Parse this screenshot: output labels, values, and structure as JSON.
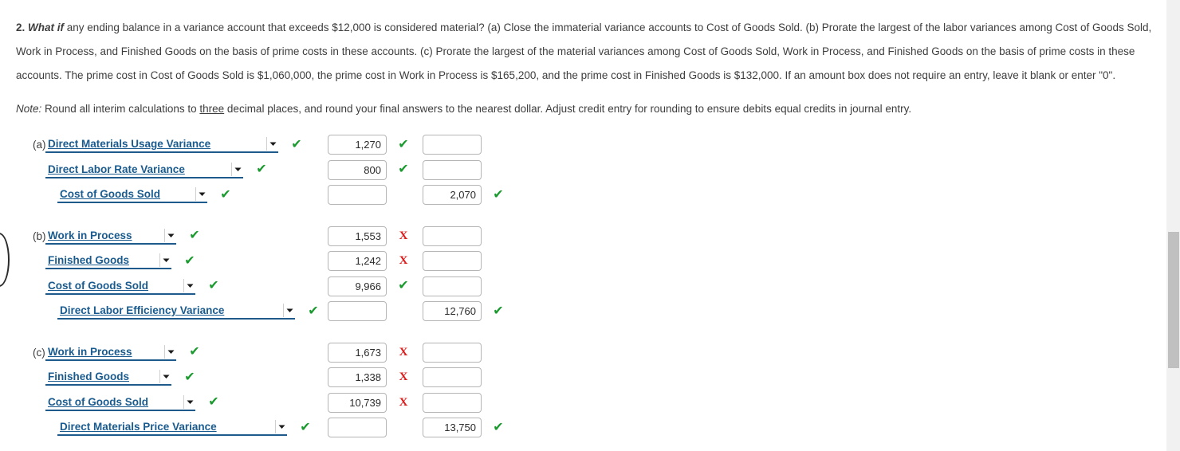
{
  "question": {
    "number": "2.",
    "emphasis": "What if",
    "body": " any ending balance in a variance account that exceeds $12,000 is considered material? (a) Close the immaterial variance accounts to Cost of Goods Sold. (b) Prorate the largest of the labor variances among Cost of Goods Sold, Work in Process, and Finished Goods on the basis of prime costs in these accounts. (c) Prorate the largest of the material variances among Cost of Goods Sold, Work in Process, and Finished Goods on the basis of prime costs in these accounts. The prime cost in Cost of Goods Sold is $1,060,000, the prime cost in Work in Process is $165,200, and the prime cost in Finished Goods is $132,000. If an amount box does not require an entry, leave it blank or enter \"0\"."
  },
  "note": {
    "lead": "Note:",
    "part1": " Round all interim calculations to ",
    "underlined": "three",
    "part2": " decimal places, and round your final answers to the nearest dollar. Adjust credit entry for rounding to ensure debits equal credits in journal entry."
  },
  "colors": {
    "account_link": "#1a5b8f",
    "tick_green": "#1a9a2e",
    "cross_red": "#e01b1b",
    "scrollbar_thumb": "#c0c0c0"
  },
  "icons": {
    "tick": "✔",
    "cross": "X",
    "chevron_down": "▼"
  },
  "entries": [
    {
      "label": "(a)",
      "rows": [
        {
          "indent": 0,
          "account": "Direct Materials Usage Variance",
          "account_width": 292,
          "account_mark": "tick",
          "debit": "1,270",
          "debit_mark": "tick",
          "credit": "",
          "credit_mark": "none"
        },
        {
          "indent": 0,
          "account": "Direct Labor Rate Variance",
          "account_width": 248,
          "account_mark": "tick",
          "debit": "800",
          "debit_mark": "tick",
          "credit": "",
          "credit_mark": "none"
        },
        {
          "indent": 15,
          "account": "Cost of Goods Sold",
          "account_width": 188,
          "account_mark": "tick",
          "debit": "",
          "debit_mark": "none",
          "credit": "2,070",
          "credit_mark": "tick"
        }
      ]
    },
    {
      "label": "(b)",
      "rows": [
        {
          "indent": 0,
          "account": "Work in Process",
          "account_width": 164,
          "account_mark": "tick",
          "debit": "1,553",
          "debit_mark": "cross",
          "credit": "",
          "credit_mark": "none"
        },
        {
          "indent": 0,
          "account": "Finished Goods",
          "account_width": 158,
          "account_mark": "tick",
          "debit": "1,242",
          "debit_mark": "cross",
          "credit": "",
          "credit_mark": "none"
        },
        {
          "indent": 0,
          "account": "Cost of Goods Sold",
          "account_width": 188,
          "account_mark": "tick",
          "debit": "9,966",
          "debit_mark": "tick",
          "credit": "",
          "credit_mark": "none"
        },
        {
          "indent": 15,
          "account": "Direct Labor Efficiency Variance",
          "account_width": 298,
          "account_mark": "tick",
          "debit": "",
          "debit_mark": "none",
          "credit": "12,760",
          "credit_mark": "tick"
        }
      ]
    },
    {
      "label": "(c)",
      "rows": [
        {
          "indent": 0,
          "account": "Work in Process",
          "account_width": 164,
          "account_mark": "tick",
          "debit": "1,673",
          "debit_mark": "cross",
          "credit": "",
          "credit_mark": "none"
        },
        {
          "indent": 0,
          "account": "Finished Goods",
          "account_width": 158,
          "account_mark": "tick",
          "debit": "1,338",
          "debit_mark": "cross",
          "credit": "",
          "credit_mark": "none"
        },
        {
          "indent": 0,
          "account": "Cost of Goods Sold",
          "account_width": 188,
          "account_mark": "tick",
          "debit": "10,739",
          "debit_mark": "cross",
          "credit": "",
          "credit_mark": "none"
        },
        {
          "indent": 15,
          "account": "Direct Materials Price Variance",
          "account_width": 288,
          "account_mark": "tick",
          "debit": "",
          "debit_mark": "none",
          "credit": "13,750",
          "credit_mark": "tick"
        }
      ]
    }
  ]
}
